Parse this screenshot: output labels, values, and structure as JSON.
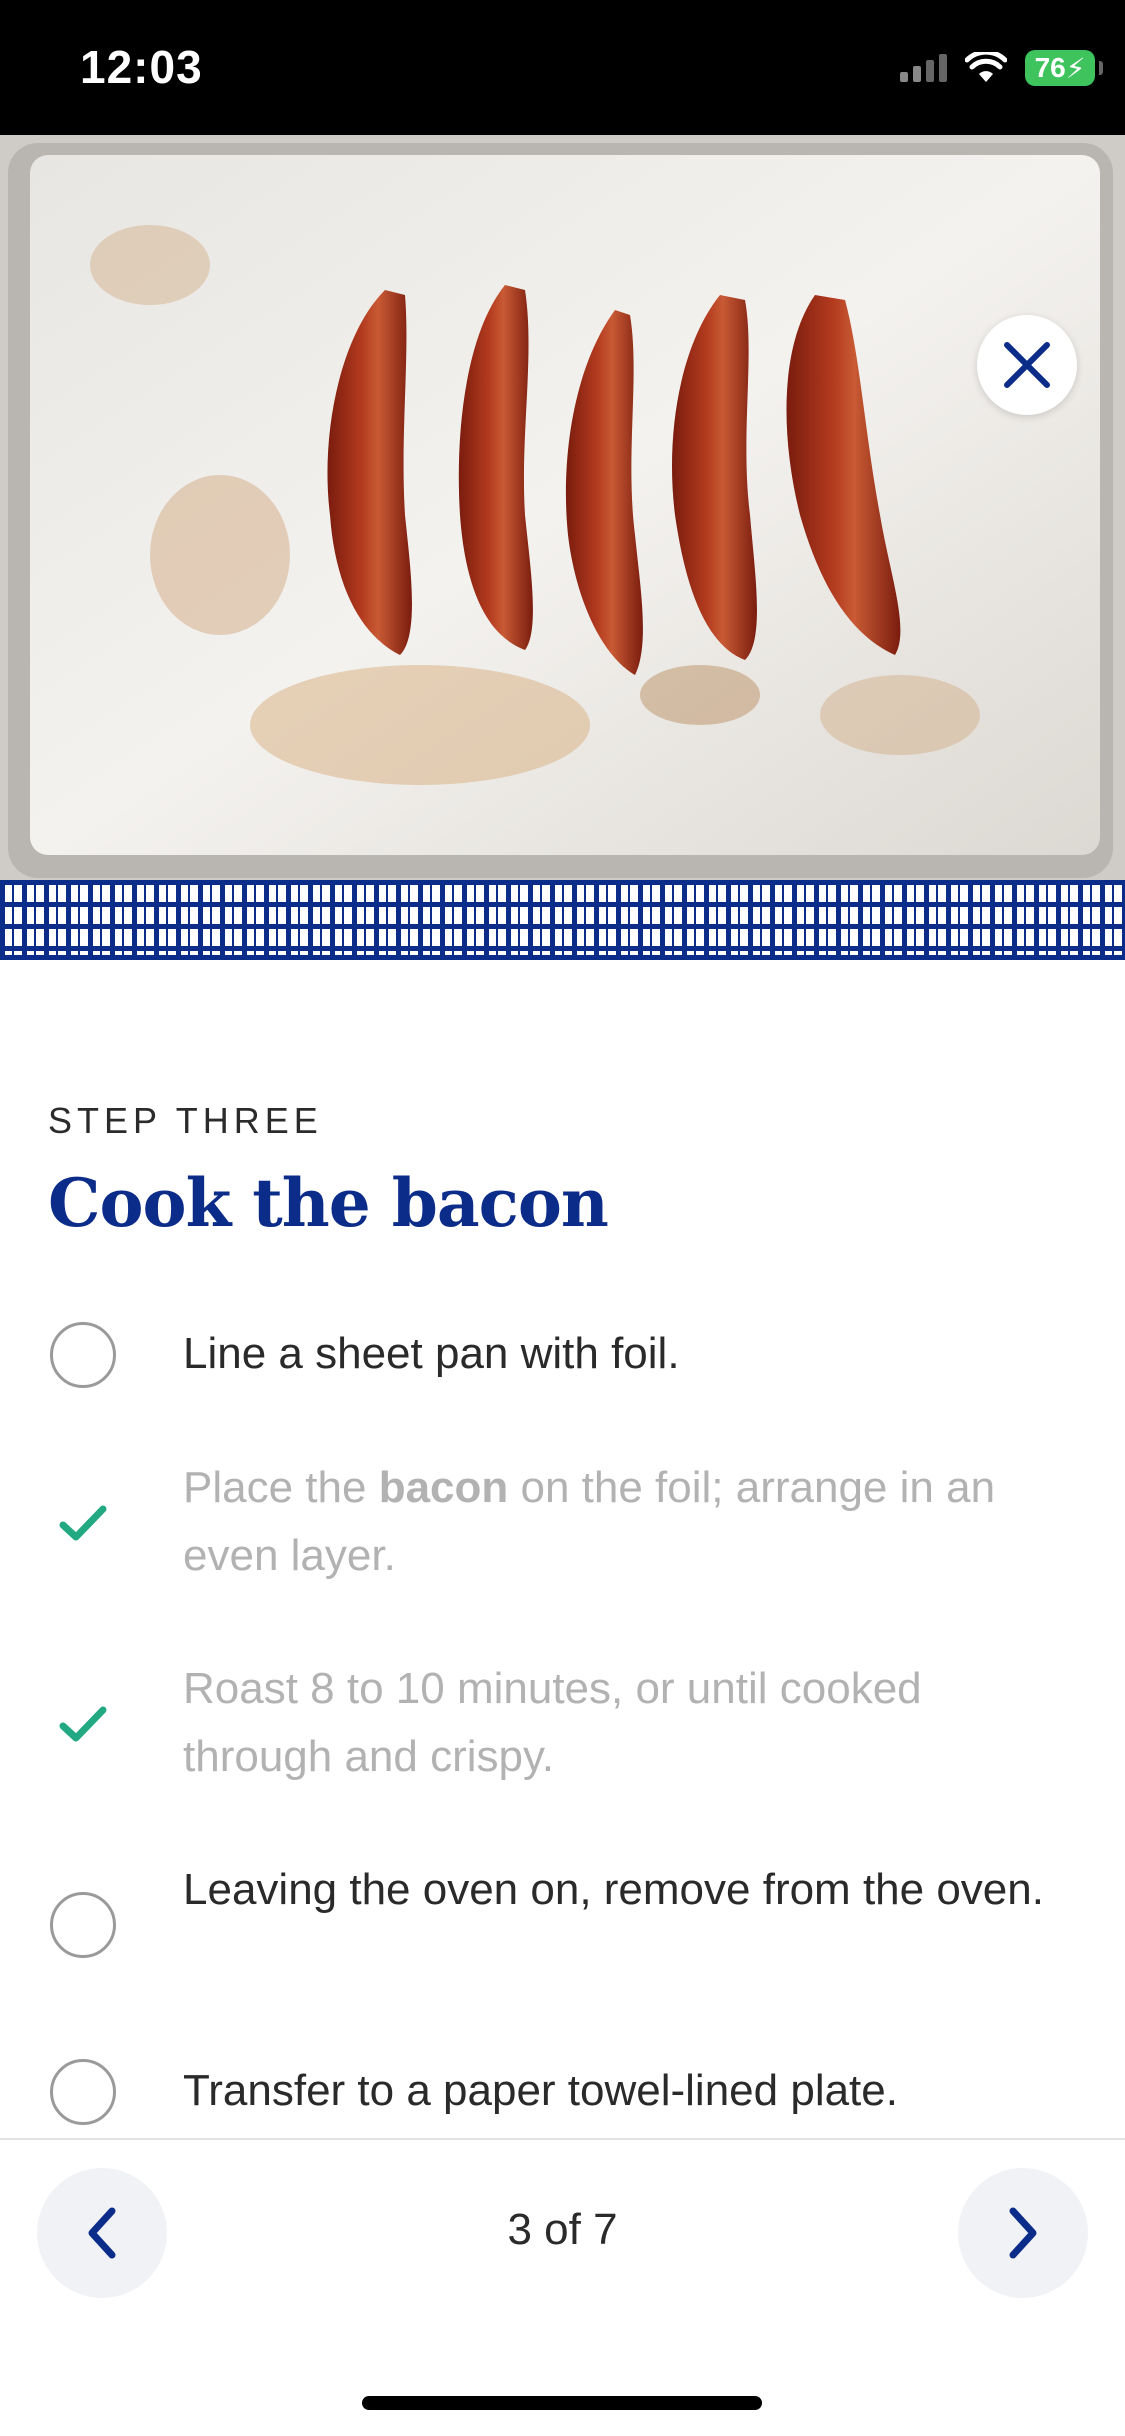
{
  "status_bar": {
    "time": "12:03",
    "battery": "76"
  },
  "hero": {
    "image_description": "bacon-on-foil-sheet-pan"
  },
  "step": {
    "label": "STEP THREE",
    "title": "Cook the bacon"
  },
  "tasks": [
    {
      "parts": [
        "Line a sheet pan with foil.",
        "",
        ""
      ],
      "checked": false
    },
    {
      "parts": [
        "Place the ",
        "bacon",
        " on the foil; arrange in an even layer."
      ],
      "checked": true
    },
    {
      "parts": [
        "Roast 8 to 10 minutes, or until cooked through and crispy.",
        "",
        ""
      ],
      "checked": true
    },
    {
      "parts": [
        "Leaving the oven on, remove from the oven.",
        "",
        ""
      ],
      "checked": false
    },
    {
      "parts": [
        "Transfer to a paper towel-lined plate.",
        "",
        ""
      ],
      "checked": false
    }
  ],
  "pager": {
    "text": "3 of 7"
  },
  "colors": {
    "brand_blue": "#0c2c8a",
    "check_green": "#22a882"
  },
  "icons": {
    "close": "close-icon",
    "prev": "chevron-left-icon",
    "next": "chevron-right-icon",
    "check": "check-icon"
  }
}
